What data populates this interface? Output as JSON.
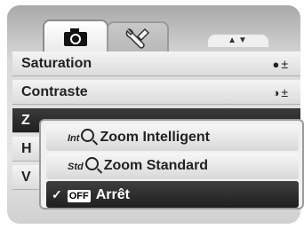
{
  "tabs": [
    {
      "name": "camera",
      "icon": "camera-icon"
    },
    {
      "name": "setup",
      "icon": "wrench-icon"
    }
  ],
  "scroll_arrows": "▲▼",
  "menu": {
    "items": [
      {
        "label": "Saturation",
        "icon": "saturation-icon"
      },
      {
        "label": "Contraste",
        "icon": "contrast-icon"
      },
      {
        "label": "Z",
        "icon": ""
      },
      {
        "label": "H",
        "icon": ""
      },
      {
        "label": "V",
        "icon": ""
      }
    ]
  },
  "popup": {
    "options": [
      {
        "icon_text": "IntQ",
        "label": "Zoom Intelligent"
      },
      {
        "icon_text": "stdQ",
        "label": "Zoom Standard"
      },
      {
        "icon_text": "OFF",
        "label": "Arrêt",
        "selected": true
      }
    ]
  },
  "colors": {
    "selected_bg": "#2a2a2a",
    "row_bg": "#ececec"
  }
}
